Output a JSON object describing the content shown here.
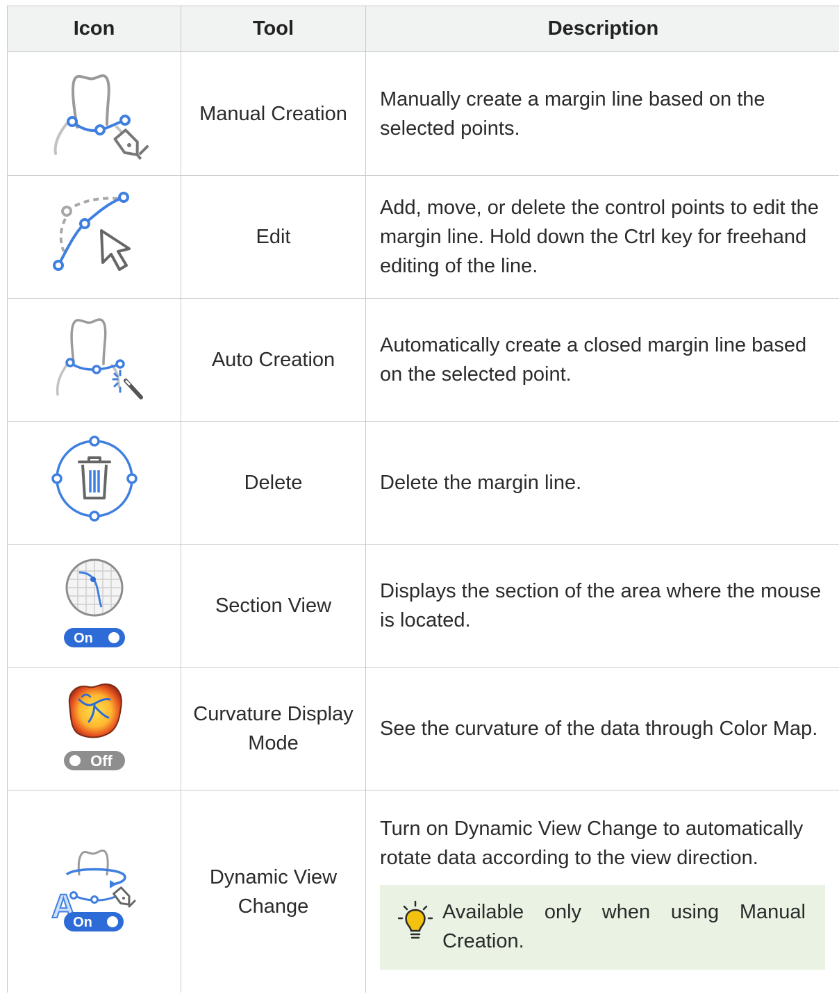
{
  "table": {
    "headers": {
      "icon": "Icon",
      "tool": "Tool",
      "description": "Description"
    },
    "rows": [
      {
        "icon": "manual-creation-icon",
        "tool": "Manual Creation",
        "description": "Manually create a margin line based on the selected points."
      },
      {
        "icon": "edit-margin-icon",
        "tool": "Edit",
        "description": "Add, move, or delete the control points to edit the margin line. Hold down the Ctrl key for freehand editing of the line."
      },
      {
        "icon": "auto-creation-icon",
        "tool": "Auto Creation",
        "description": "Automatically create a closed margin line based on the selected point."
      },
      {
        "icon": "delete-margin-icon",
        "tool": "Delete",
        "description": "Delete the margin line."
      },
      {
        "icon": "section-view-icon",
        "tool": "Section View",
        "description": "Displays the section of the area where the mouse is located.",
        "toggle": "On"
      },
      {
        "icon": "curvature-display-icon",
        "tool": "Curvature Display Mode",
        "description": "See the curvature of the data through Color Map.",
        "toggle": "Off"
      },
      {
        "icon": "dynamic-view-change-icon",
        "tool": "Dynamic View Change",
        "description": "Turn on Dynamic View Change to automatically rotate data according to the view direction.",
        "toggle": "On",
        "tip": "Available only when using Manual Creation."
      }
    ]
  },
  "colors": {
    "accent_blue": "#3f7fe0",
    "toggle_on": "#2d6bd6",
    "toggle_off": "#8e8e8e",
    "tip_background": "#e9f2e3",
    "tip_bulb": "#f2c20f",
    "header_background": "#f1f2f2"
  }
}
